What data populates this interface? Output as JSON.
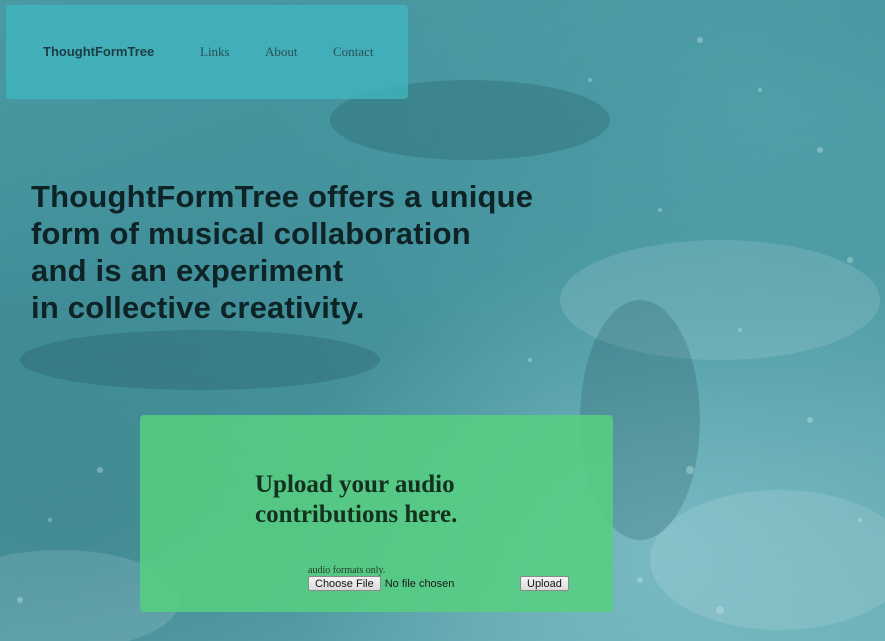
{
  "nav": {
    "brand": "ThoughtFormTree",
    "links": [
      "Links",
      "About",
      "Contact"
    ]
  },
  "hero": {
    "lines": [
      "ThoughtFormTree offers a unique",
      "form of musical collaboration",
      "and is an experiment",
      "in collective creativity."
    ]
  },
  "upload": {
    "title_lines": [
      "Upload your audio",
      "contributions here."
    ],
    "formats_note": "audio formats only.",
    "choose_label": "Choose File",
    "file_status": "No file chosen",
    "submit_label": "Upload"
  },
  "colors": {
    "navbar": "#40b9c3",
    "upload_card": "#56ce82",
    "background": "#4a9aa3"
  }
}
